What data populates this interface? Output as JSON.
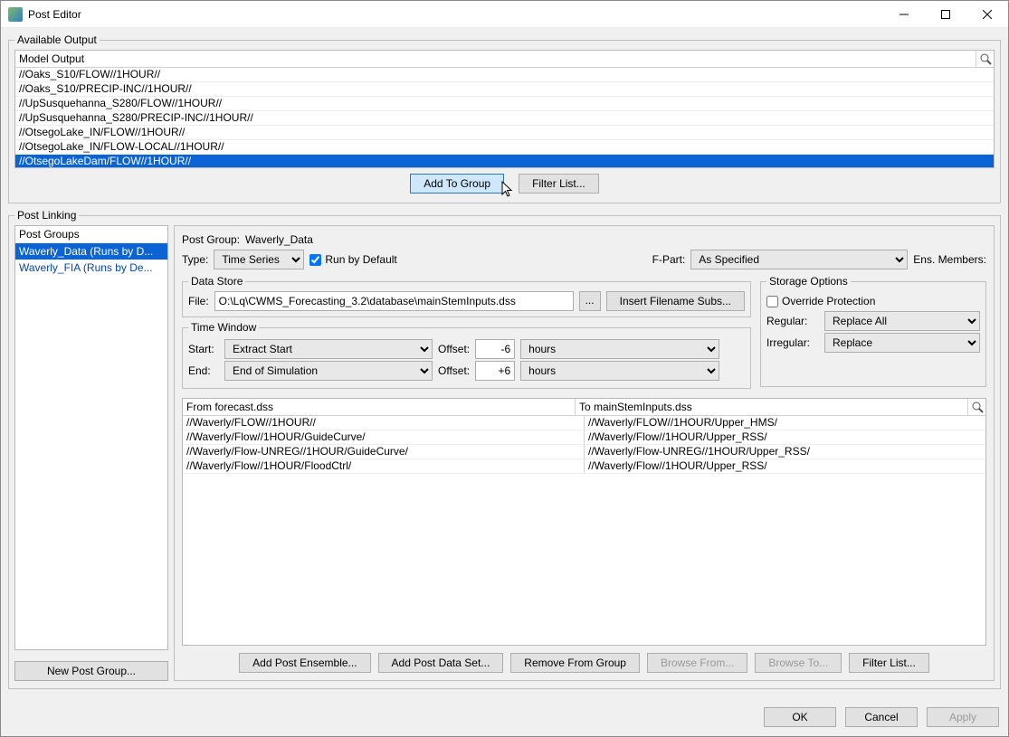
{
  "window": {
    "title": "Post Editor"
  },
  "available": {
    "legend": "Available Output",
    "column": "Model Output",
    "rows": [
      "//Oaks_S10/FLOW//1HOUR//",
      "//Oaks_S10/PRECIP-INC//1HOUR//",
      "//UpSusquehanna_S280/FLOW//1HOUR//",
      "//UpSusquehanna_S280/PRECIP-INC//1HOUR//",
      "//OtsegoLake_IN/FLOW//1HOUR//",
      "//OtsegoLake_IN/FLOW-LOCAL//1HOUR//",
      "//OtsegoLakeDam/FLOW//1HOUR//"
    ],
    "selectedIndex": 6,
    "add_btn": "Add To Group",
    "filter_btn": "Filter List..."
  },
  "linking": {
    "legend": "Post Linking",
    "groups_header": "Post Groups",
    "groups": [
      "Waverly_Data (Runs by D...",
      "Waverly_FIA (Runs by De..."
    ],
    "groups_selected": 0,
    "new_group_btn": "New Post Group..."
  },
  "details": {
    "group_label": "Post Group:",
    "group_name": "Waverly_Data",
    "type_label": "Type:",
    "type_value": "Time Series",
    "run_default": "Run by Default",
    "run_default_checked": true,
    "fpart_label": "F-Part:",
    "fpart_value": "As Specified",
    "ens_label": "Ens. Members:"
  },
  "datastore": {
    "legend": "Data Store",
    "file_label": "File:",
    "file_value": "O:\\Lq\\CWMS_Forecasting_3.2\\database\\mainStemInputs.dss",
    "ellipsis": "...",
    "insert_btn": "Insert Filename Subs..."
  },
  "timewindow": {
    "legend": "Time Window",
    "start_label": "Start:",
    "start_value": "Extract Start",
    "end_label": "End:",
    "end_value": "End of Simulation",
    "offset_label": "Offset:",
    "start_offset": "-6",
    "end_offset": "+6",
    "unit": "hours"
  },
  "storage": {
    "legend": "Storage Options",
    "override": "Override Protection",
    "override_checked": false,
    "regular_label": "Regular:",
    "regular_value": "Replace All",
    "irregular_label": "Irregular:",
    "irregular_value": "Replace"
  },
  "mapping": {
    "from_header": "From forecast.dss",
    "to_header": "To mainStemInputs.dss",
    "rows": [
      {
        "from": "//Waverly/FLOW//1HOUR//",
        "to": "//Waverly/FLOW//1HOUR/Upper_HMS/"
      },
      {
        "from": "//Waverly/Flow//1HOUR/GuideCurve/",
        "to": "//Waverly/Flow//1HOUR/Upper_RSS/"
      },
      {
        "from": "//Waverly/Flow-UNREG//1HOUR/GuideCurve/",
        "to": "//Waverly/Flow-UNREG//1HOUR/Upper_RSS/"
      },
      {
        "from": "//Waverly/Flow//1HOUR/FloodCtrl/",
        "to": "//Waverly/Flow//1HOUR/Upper_RSS/"
      }
    ]
  },
  "bottom": {
    "add_ens": "Add Post Ensemble...",
    "add_set": "Add Post Data Set...",
    "remove": "Remove From Group",
    "browse_from": "Browse From...",
    "browse_to": "Browse To...",
    "filter": "Filter List..."
  },
  "dlg": {
    "ok": "OK",
    "cancel": "Cancel",
    "apply": "Apply"
  }
}
